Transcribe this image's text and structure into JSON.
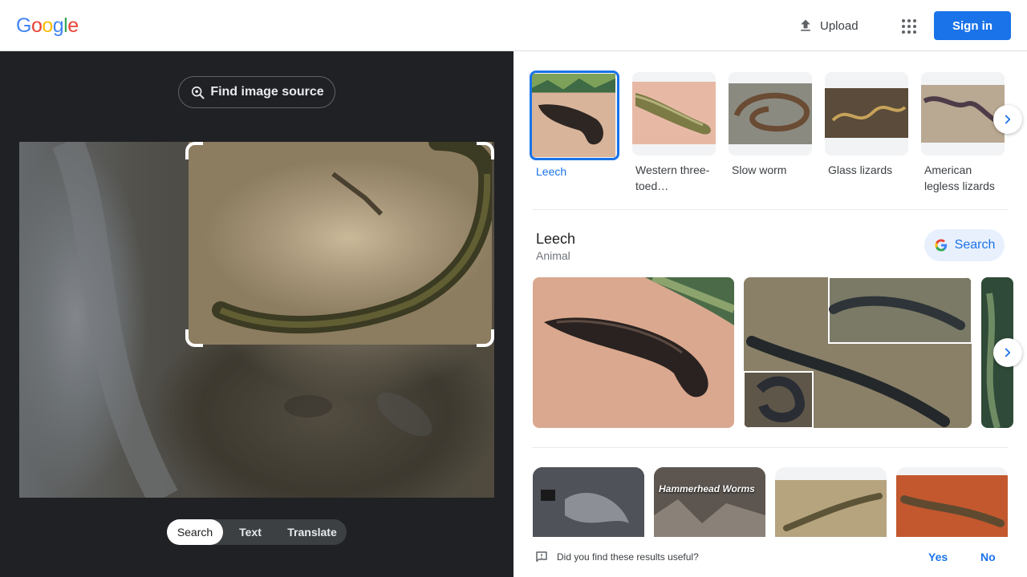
{
  "header": {
    "logo_letters": [
      {
        "ch": "G",
        "color": "#4285F4"
      },
      {
        "ch": "o",
        "color": "#EA4335"
      },
      {
        "ch": "o",
        "color": "#FBBC05"
      },
      {
        "ch": "g",
        "color": "#4285F4"
      },
      {
        "ch": "l",
        "color": "#34A853"
      },
      {
        "ch": "e",
        "color": "#EA4335"
      }
    ],
    "upload_label": "Upload",
    "apps_icon": "apps-grid-icon",
    "signin_label": "Sign in"
  },
  "lens": {
    "find_source_label": "Find image source",
    "modes": [
      {
        "label": "Search",
        "active": true
      },
      {
        "label": "Text",
        "active": false
      },
      {
        "label": "Translate",
        "active": false
      }
    ]
  },
  "visual_matches": [
    {
      "label": "Leech",
      "selected": true
    },
    {
      "label": "Western three-toed…",
      "selected": false
    },
    {
      "label": "Slow worm",
      "selected": false
    },
    {
      "label": "Glass lizards",
      "selected": false
    },
    {
      "label": "American legless lizards",
      "selected": false
    }
  ],
  "knowledge": {
    "title": "Leech",
    "subtitle": "Animal",
    "search_label": "Search"
  },
  "result_cards": [
    {
      "overlay_text": ""
    },
    {
      "overlay_text": "Hammerhead Worms"
    },
    {
      "overlay_text": ""
    },
    {
      "overlay_text": ""
    }
  ],
  "feedback": {
    "question": "Did you find these results useful?",
    "yes_label": "Yes",
    "no_label": "No"
  },
  "colors": {
    "accent": "#1a73e8",
    "dark_panel": "#202124"
  }
}
